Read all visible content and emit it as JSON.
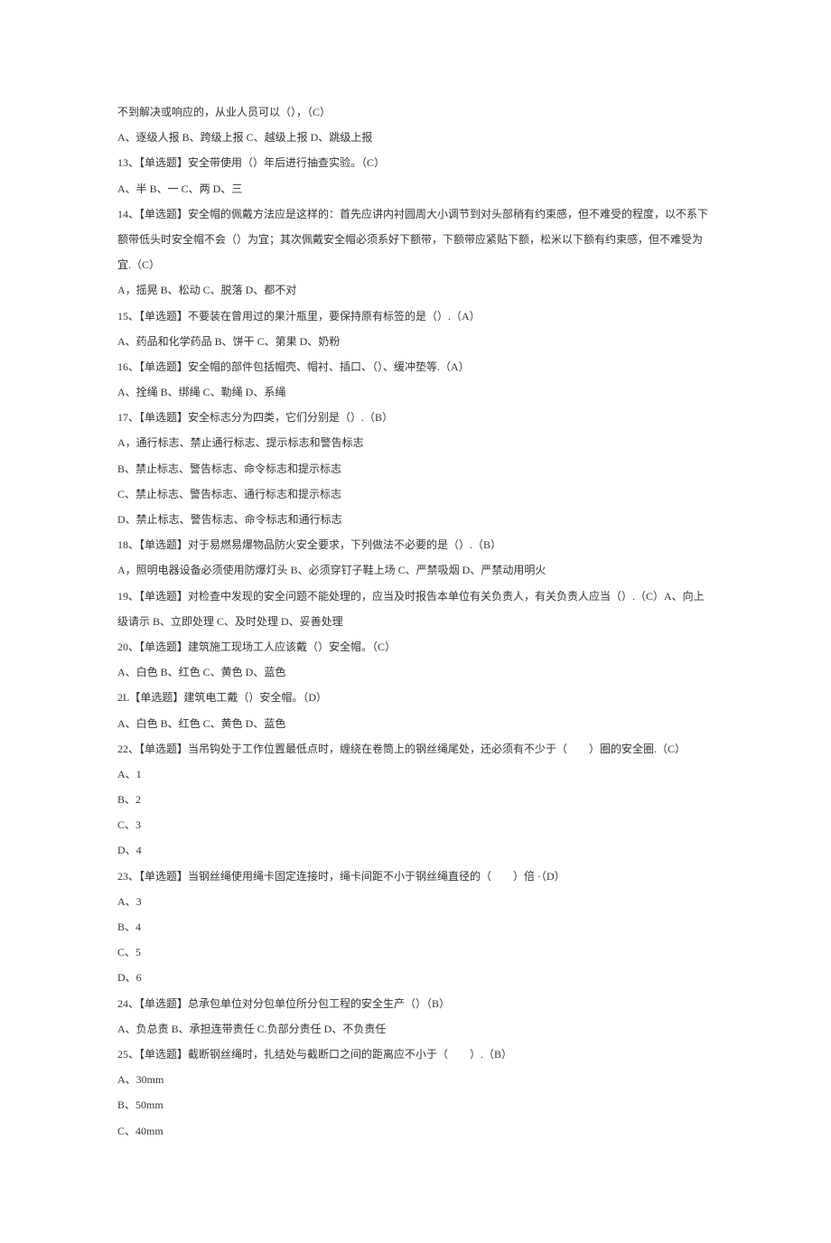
{
  "lines": [
    "不到解决或响应的，从业人员可以（），（C）",
    "A、逐级人报 B、跨级上报 C、越级上报 D、跳级上报",
    "13、【单选题】安全带使用（）年后进行抽查实验。（C）",
    "A、半 B、一 C、两 D、三",
    "14、【单选题】安全帽的佩戴方法应是这样的：首先应讲内衬圆周大小调节到对头部稍有约束感，但不难受的程度，以不系下额带低头时安全帽不会（）为宜；其次佩戴安全帽必须系好下额带，下额带应紧贴下额，松米以下额有约束感，但不难受为宜.（C）",
    "A，摇晃 B、松动 C、脱落 D、都不对",
    "15、【单选题】不要装在曾用过的果汁瓶里，要保持原有标签的是（）.（A）",
    "A、药品和化学药品 B、饼干 C、第果 D、奶粉",
    "16、【单选题】安全帽的部件包括帽壳、帽衬、插口、（）、缓冲垫等.（A）",
    "A、拴绳 B、绑绳 C、勒绳 D、系绳",
    "17、【单选题】安全标志分为四类，它们分别是（）.（B）",
    "A，通行标志、禁止通行标志、提示标志和警告标志",
    "B、禁止标志、警告标志、命令标志和提示标志",
    "C、禁止标志、警告标志、通行标志和提示标志",
    "D、禁止标志、警告标志、命令标志和通行标志",
    "18、【单选题】对于易燃易爆物品防火安全要求，下列做法不必要的是（）.（B）",
    "A，照明电器设备必须使用防爆灯头 B、必须穿钉子鞋上场 C、严禁吸烟 D、严禁动用明火",
    "19、【单选题】对检查中发现的安全问题不能处理的，应当及时报告本单位有关负责人，有关负责人应当（）.（C）A、向上级请示 B、立即处理 C、及时处理 D、妥善处理",
    "20、【单选题】建筑施工现场工人应该戴（）安全帽。（C）",
    "A、白色 B、红色 C、黄色 D、蓝色",
    "2L【单选题】建筑电工戴（）安全帽。（D）",
    "A、白色 B、红色 C、黄色 D、蓝色",
    "22、【单选题】当吊钩处于工作位置最低点时，缠绕在卷筒上的钢丝绳尾处，还必须有不少于（　　）圈的安全圈.（C）",
    "A、1",
    "B、2",
    "C、3",
    "D、4",
    "23、【单选题】当钢丝绳使用绳卡固定连接时，绳卡间距不小于钢丝绳直径的（　　）倍 ·（D）",
    "A、3",
    "B、4",
    "C、5",
    "D、6",
    "24、【单选题】总承包单位对分包单位所分包工程的安全生产（）（B）",
    "A、负总责 B、承担连带责任 C.负部分责任 D、不负责任",
    "25、【单选题】截断钢丝绳时，扎结处与截断口之间的距离应不小于（　　）.（B）",
    "A、30mm",
    "B、50mm",
    "C、40mm"
  ]
}
